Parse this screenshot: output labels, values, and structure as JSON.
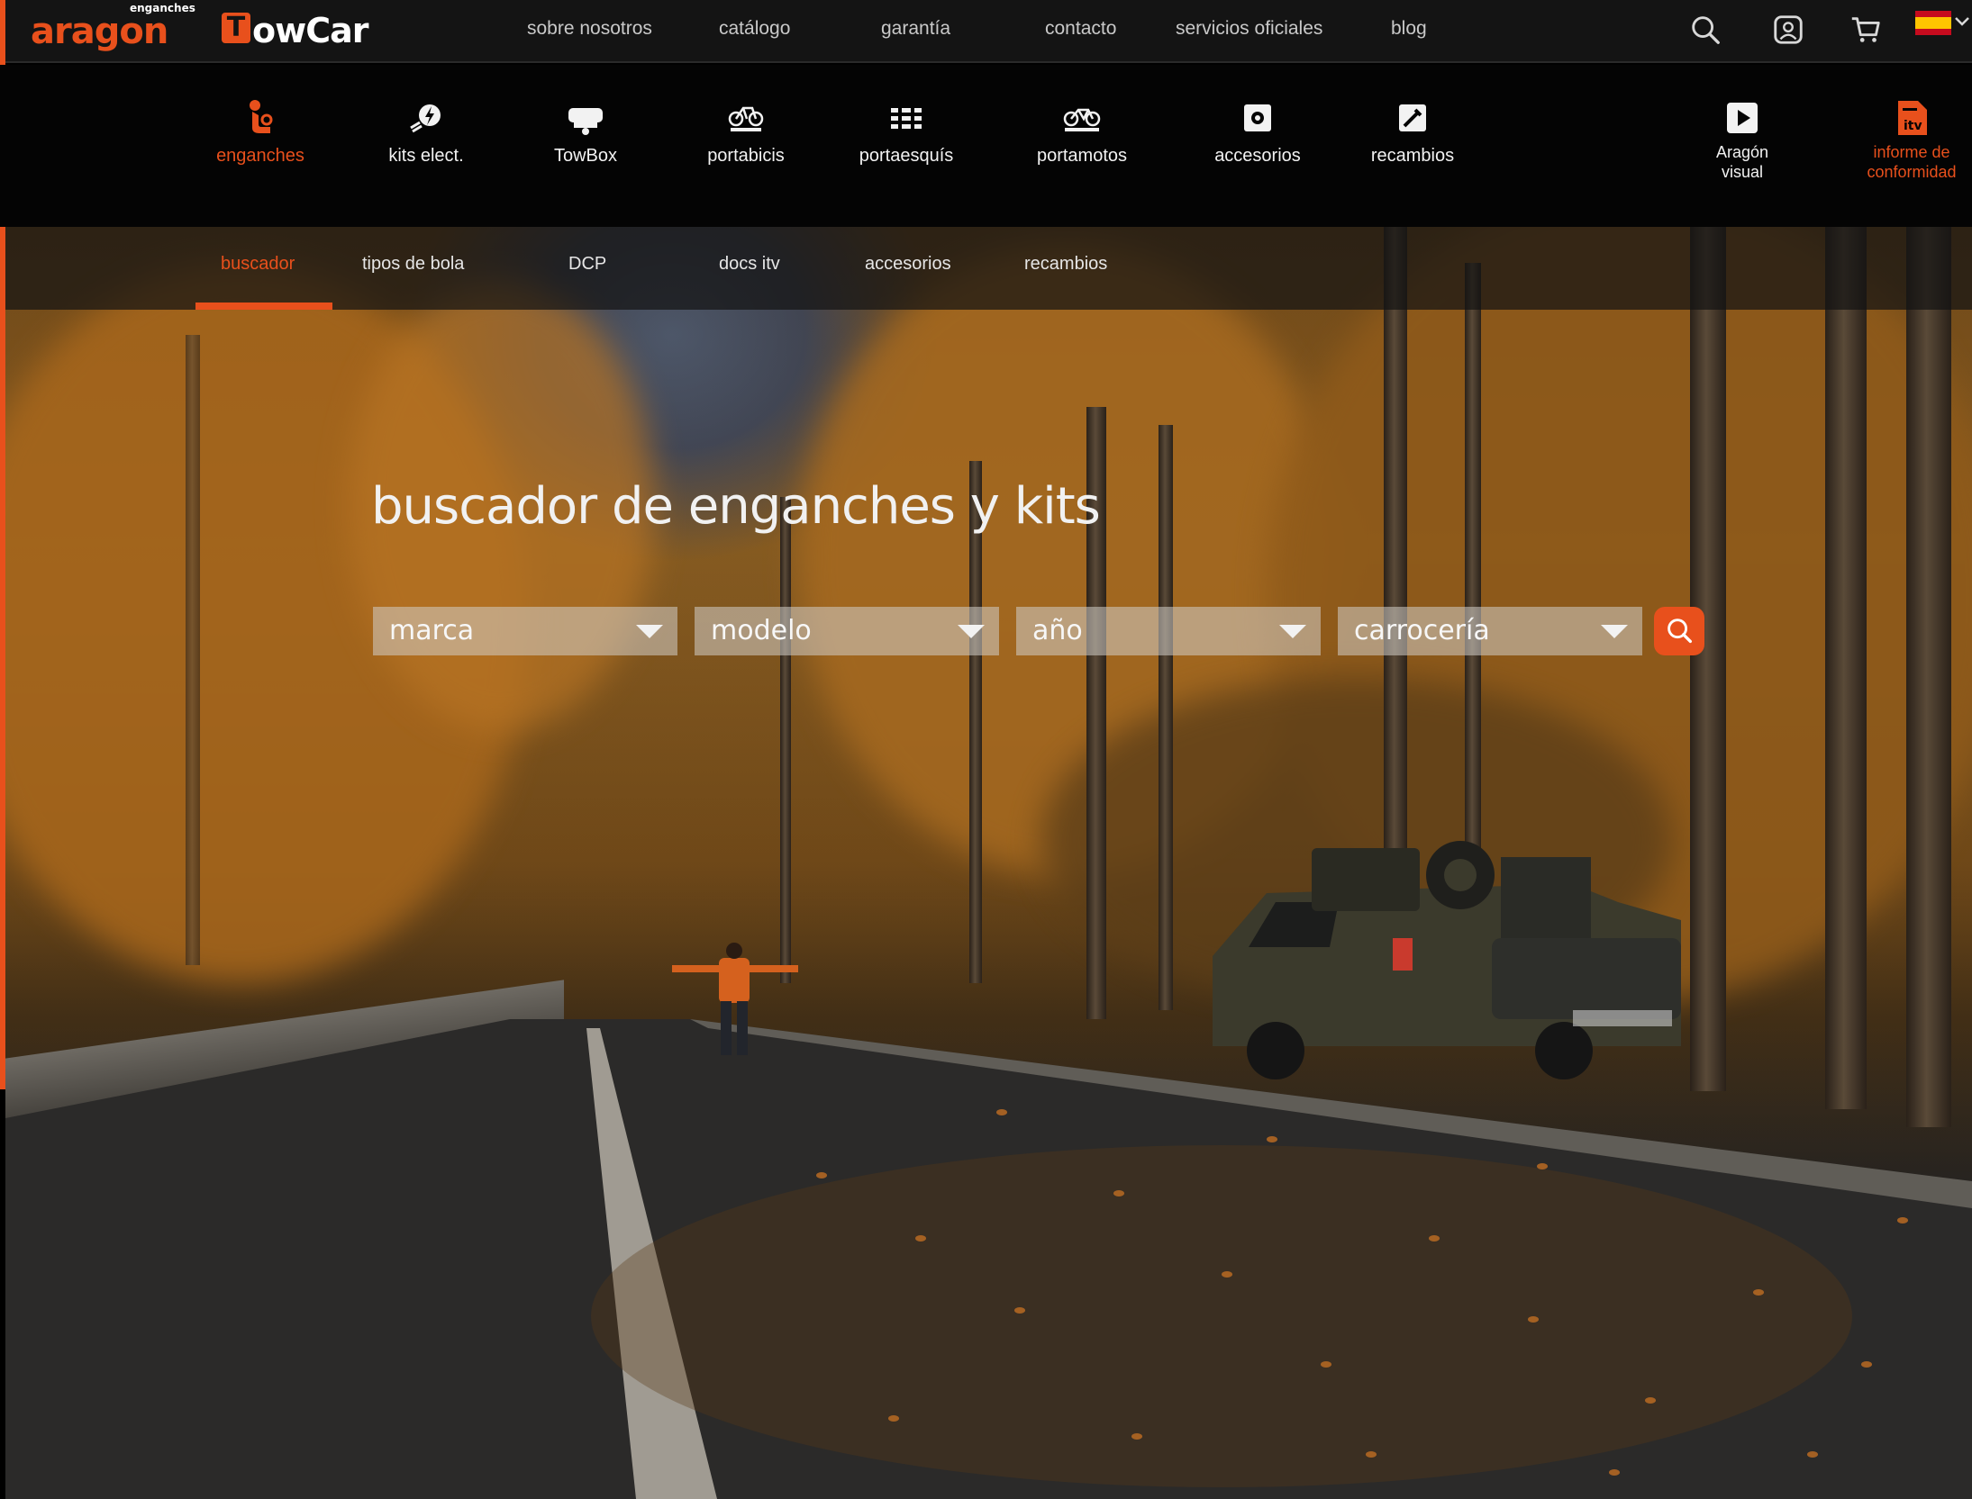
{
  "brand": {
    "aragon_word": "aragon",
    "aragon_tag": "enganches",
    "towcar_letter": "T",
    "towcar_word": "owCar"
  },
  "topnav": [
    "sobre nosotros",
    "catálogo",
    "garantía",
    "contacto",
    "servicios oficiales",
    "blog"
  ],
  "icons": {
    "search": "search-icon",
    "account": "user-icon",
    "cart": "cart-icon",
    "language": "spain-flag-icon"
  },
  "categories": [
    {
      "label": "enganches",
      "icon": "towbar-icon"
    },
    {
      "label": "kits elect.",
      "icon": "electric-plug-icon"
    },
    {
      "label": "TowBox",
      "icon": "towbox-icon"
    },
    {
      "label": "portabicis",
      "icon": "bike-carrier-icon"
    },
    {
      "label": "portaesquís",
      "icon": "ski-carrier-icon"
    },
    {
      "label": "portamotos",
      "icon": "motorbike-carrier-icon"
    },
    {
      "label": "accesorios",
      "icon": "accessories-icon"
    },
    {
      "label": "recambios",
      "icon": "spare-parts-icon"
    },
    {
      "label_line1": "Aragón",
      "label_line2": "visual",
      "icon": "play-icon"
    },
    {
      "label_line1": "informe de",
      "label_line2": "conformidad",
      "icon": "itv-document-icon"
    }
  ],
  "subnav": [
    "buscador",
    "tipos de bola",
    "DCP",
    "docs itv",
    "accesorios",
    "recambios"
  ],
  "hero": {
    "title": "buscador de enganches y kits",
    "selects": [
      "marca",
      "modelo",
      "año",
      "carrocería"
    ]
  },
  "colors": {
    "accent": "#e8501c",
    "topbar": "#141414",
    "catbar": "#040404"
  }
}
